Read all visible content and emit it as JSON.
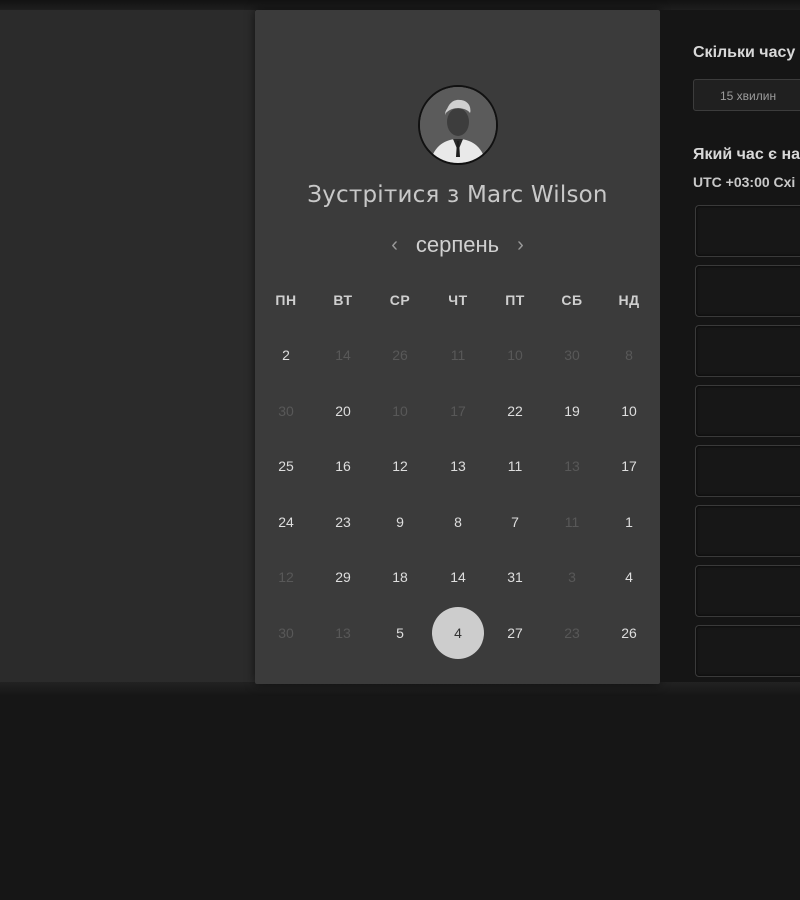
{
  "calendar": {
    "title_prefix": "Зустрітися з",
    "host_name": "Marc Wilson",
    "month": "серпень",
    "weekdays": [
      "ПН",
      "ВТ",
      "СР",
      "ЧТ",
      "ПТ",
      "СБ",
      "НД"
    ],
    "weeks": [
      [
        {
          "d": "2",
          "on": true
        },
        {
          "d": "14",
          "on": false
        },
        {
          "d": "26",
          "on": false
        },
        {
          "d": "11",
          "on": false
        },
        {
          "d": "10",
          "on": false
        },
        {
          "d": "30",
          "on": false
        },
        {
          "d": "8",
          "on": false
        }
      ],
      [
        {
          "d": "30",
          "on": false
        },
        {
          "d": "20",
          "on": true
        },
        {
          "d": "10",
          "on": false
        },
        {
          "d": "17",
          "on": false
        },
        {
          "d": "22",
          "on": true
        },
        {
          "d": "19",
          "on": true
        },
        {
          "d": "10",
          "on": true
        }
      ],
      [
        {
          "d": "25",
          "on": true
        },
        {
          "d": "16",
          "on": true
        },
        {
          "d": "12",
          "on": true
        },
        {
          "d": "13",
          "on": true
        },
        {
          "d": "11",
          "on": true
        },
        {
          "d": "13",
          "on": false
        },
        {
          "d": "17",
          "on": true
        }
      ],
      [
        {
          "d": "24",
          "on": true
        },
        {
          "d": "23",
          "on": true
        },
        {
          "d": "9",
          "on": true
        },
        {
          "d": "8",
          "on": true
        },
        {
          "d": "7",
          "on": true
        },
        {
          "d": "11",
          "on": false
        },
        {
          "d": "1",
          "on": true
        }
      ],
      [
        {
          "d": "12",
          "on": false
        },
        {
          "d": "29",
          "on": true
        },
        {
          "d": "18",
          "on": true
        },
        {
          "d": "14",
          "on": true
        },
        {
          "d": "31",
          "on": true
        },
        {
          "d": "3",
          "on": false
        },
        {
          "d": "4",
          "on": true
        }
      ],
      [
        {
          "d": "30",
          "on": false
        },
        {
          "d": "13",
          "on": false
        },
        {
          "d": "5",
          "on": true
        },
        {
          "d": "4",
          "on": true,
          "selected": true
        },
        {
          "d": "27",
          "on": true
        },
        {
          "d": "23",
          "on": false
        },
        {
          "d": "26",
          "on": true
        }
      ]
    ]
  },
  "right": {
    "duration_question": "Скільки часу",
    "duration_value": "15 хвилин",
    "time_question": "Який час є на",
    "timezone": "UTC +03:00 Схі",
    "slot_count": 8
  },
  "icons": {
    "prev": "chevron-left-icon",
    "next": "chevron-right-icon"
  }
}
